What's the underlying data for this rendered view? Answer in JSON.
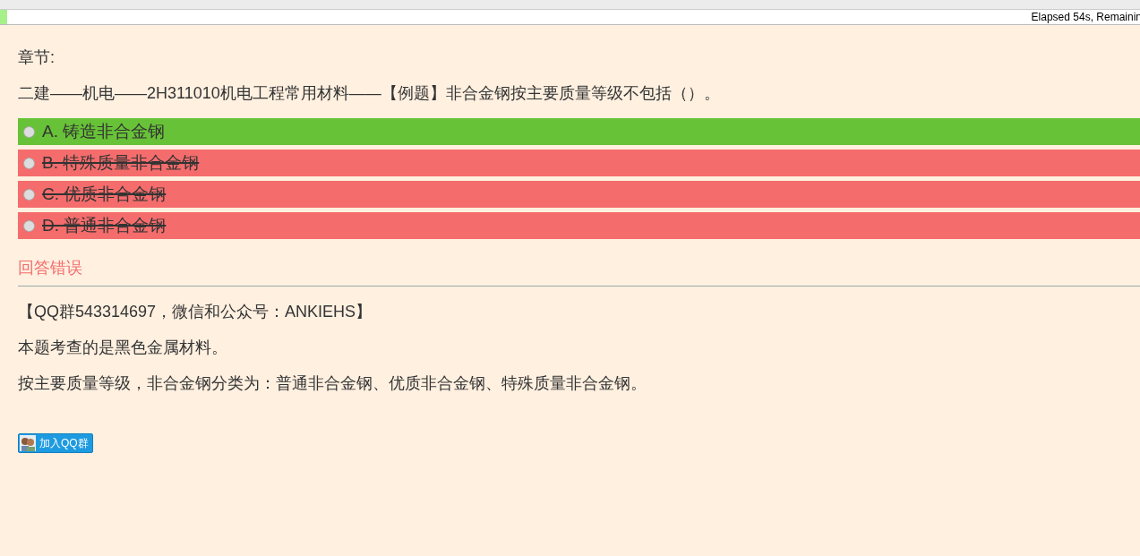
{
  "progress": {
    "level": 0.006,
    "text": "Elapsed 54s, Remainin"
  },
  "chapter_label": "章节:",
  "question": "二建——机电——2H311010机电工程常用材料——【例题】非合金钢按主要质量等级不包括（）。",
  "options": [
    {
      "label": "A. 铸造非合金钢",
      "selected": false,
      "kind": "correct"
    },
    {
      "label": "B. 特殊质量非合金钢",
      "selected": false,
      "kind": "wrong"
    },
    {
      "label": "C. 优质非合金钢",
      "selected": false,
      "kind": "wrong"
    },
    {
      "label": "D. 普通非合金钢",
      "selected": false,
      "kind": "wrong"
    }
  ],
  "verdict": "回答错误",
  "explanation": [
    "【QQ群543314697，微信和公众号：ANKIEHS】",
    "本题考查的是黑色金属材料。",
    "按主要质量等级，非合金钢分类为：普通非合金钢、优质非合金钢、特殊质量非合金钢。"
  ],
  "join_button": "加入QQ群"
}
